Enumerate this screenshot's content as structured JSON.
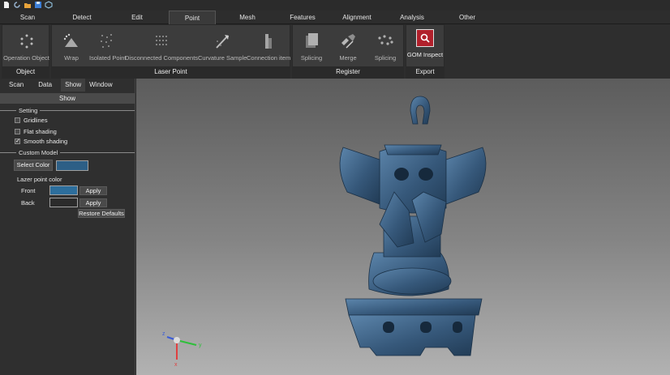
{
  "tabs": [
    "Scan",
    "Detect",
    "Edit",
    "Point",
    "Mesh",
    "Features",
    "Alignment",
    "Analysis",
    "Other"
  ],
  "active_tab": "Point",
  "ribbon": {
    "object_group": {
      "label": "Object",
      "tools": [
        "Operation Object"
      ]
    },
    "laser_group": {
      "label": "Laser Point",
      "tools": [
        "Wrap",
        "Isolated Point",
        "Disconnected Components",
        "Curvature Sample",
        "Connection item"
      ]
    },
    "register_group": {
      "label": "Register",
      "tools": [
        "Splicing",
        "Merge",
        "Splicing"
      ]
    },
    "export_group": {
      "label": "Export",
      "tools": [
        "GOM Inspect"
      ]
    }
  },
  "panel": {
    "tabs": [
      "Scan",
      "Data",
      "Show",
      "Window"
    ],
    "active_tab": "Show",
    "header": "Show",
    "setting": {
      "title": "Setting",
      "gridlines": {
        "label": "Gridlines",
        "checked": false
      },
      "flat": {
        "label": "Flat shading",
        "checked": false
      },
      "smooth": {
        "label": "Smooth shading",
        "checked": true,
        "mark": "✓"
      }
    },
    "custom": {
      "title": "Custom Model",
      "select_color": "Select Color",
      "model_color": "#2d5f86",
      "lazer_title": "Lazer point color",
      "front_label": "Front",
      "front_color": "#2d6e9c",
      "back_label": "Back",
      "back_color": "#2b2b2b",
      "apply": "Apply",
      "restore": "Restore Defaults"
    }
  },
  "axes": {
    "x_label": "x",
    "y_label": "y",
    "z_label": "z"
  },
  "colors": {
    "model": "#3c5f80",
    "gom_red": "#b1202b"
  }
}
